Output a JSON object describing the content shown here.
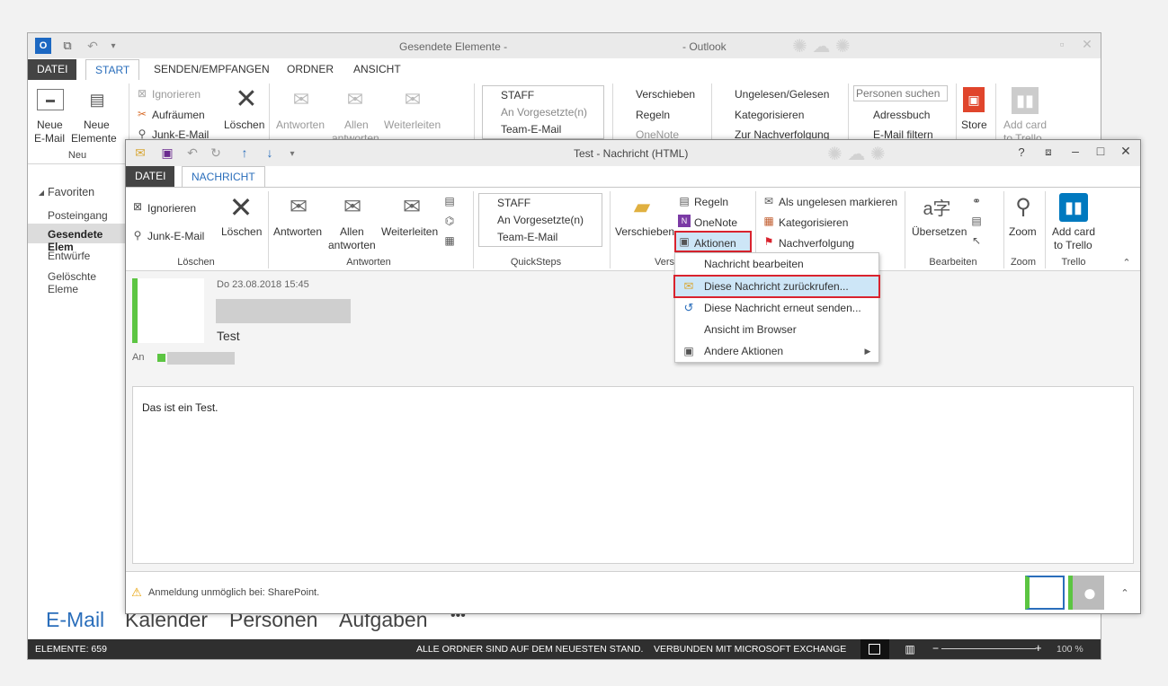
{
  "main_window": {
    "title": "Gesendete Elemente -",
    "title_app": "- Outlook",
    "tabs": [
      "DATEI",
      "START",
      "SENDEN/EMPFANGEN",
      "ORDNER",
      "ANSICHT"
    ],
    "ribbon": {
      "new_email": [
        "Neue",
        "E-Mail"
      ],
      "new_items": [
        "Neue",
        "Elemente"
      ],
      "group_new": "Neu",
      "ignore": "Ignorieren",
      "cleanup": "Aufräumen",
      "junk": "Junk-E-Mail",
      "delete": "Löschen",
      "reply": "Antworten",
      "reply_all": [
        "Allen",
        "antworten"
      ],
      "forward": "Weiterleiten",
      "quicksteps": [
        "STAFF",
        "An Vorgesetzte(n)",
        "Team-E-Mail"
      ],
      "move": "Verschieben",
      "rules": "Regeln",
      "onenote": "OneNote",
      "unread_read": "Ungelesen/Gelesen",
      "categorize": "Kategorisieren",
      "followup": "Zur Nachverfolgung",
      "search_people_placeholder": "Personen suchen",
      "address_book": "Adressbuch",
      "filter_email": "E-Mail filtern",
      "store": "Store",
      "add_card": [
        "Add card",
        "to Trello"
      ]
    },
    "nav": {
      "favorites": "Favoriten",
      "items": [
        "Posteingang",
        "Gesendete Elem",
        "Entwürfe",
        "Gelöschte Eleme"
      ]
    },
    "bottom_nav": [
      "E-Mail",
      "Kalender",
      "Personen",
      "Aufgaben",
      "•••"
    ],
    "status": {
      "items": "ELEMENTE: 659",
      "uptodate": "ALLE ORDNER SIND AUF DEM NEUESTEN STAND.",
      "connected": "VERBUNDEN MIT MICROSOFT EXCHANGE",
      "zoom": "100 %"
    }
  },
  "message_window": {
    "title": "Test - Nachricht (HTML)",
    "tabs": [
      "DATEI",
      "NACHRICHT"
    ],
    "ribbon": {
      "ignore": "Ignorieren",
      "junk": "Junk-E-Mail",
      "delete": "Löschen",
      "group_delete": "Löschen",
      "reply": "Antworten",
      "reply_all": [
        "Allen",
        "antworten"
      ],
      "forward": "Weiterleiten",
      "group_respond": "Antworten",
      "quicksteps": [
        "STAFF",
        "An Vorgesetzte(n)",
        "Team-E-Mail"
      ],
      "group_quicksteps": "QuickSteps",
      "move": "Verschieben",
      "rules": "Regeln",
      "onenote": "OneNote",
      "actions": "Aktionen",
      "group_move": "Vers",
      "mark_unread": "Als ungelesen markieren",
      "categorize": "Kategorisieren",
      "followup": "Nachverfolgung",
      "translate": "Übersetzen",
      "group_edit": "Bearbeiten",
      "zoom": "Zoom",
      "group_zoom": "Zoom",
      "add_card": [
        "Add card",
        "to Trello"
      ],
      "group_trello": "Trello"
    },
    "actions_menu": [
      "Nachricht bearbeiten",
      "Diese Nachricht zurückrufen...",
      "Diese Nachricht erneut senden...",
      "Ansicht im Browser",
      "Andere Aktionen"
    ],
    "header": {
      "date": "Do 23.08.2018 15:45",
      "subject": "Test",
      "to_label": "An"
    },
    "body": "Das ist ein Test.",
    "status": "Anmeldung unmöglich bei: SharePoint."
  },
  "colors": {
    "accent": "#2a6ebb",
    "highlight_red": "#d9232e",
    "presence_green": "#5cc542",
    "menu_highlight": "#cde6f7"
  }
}
